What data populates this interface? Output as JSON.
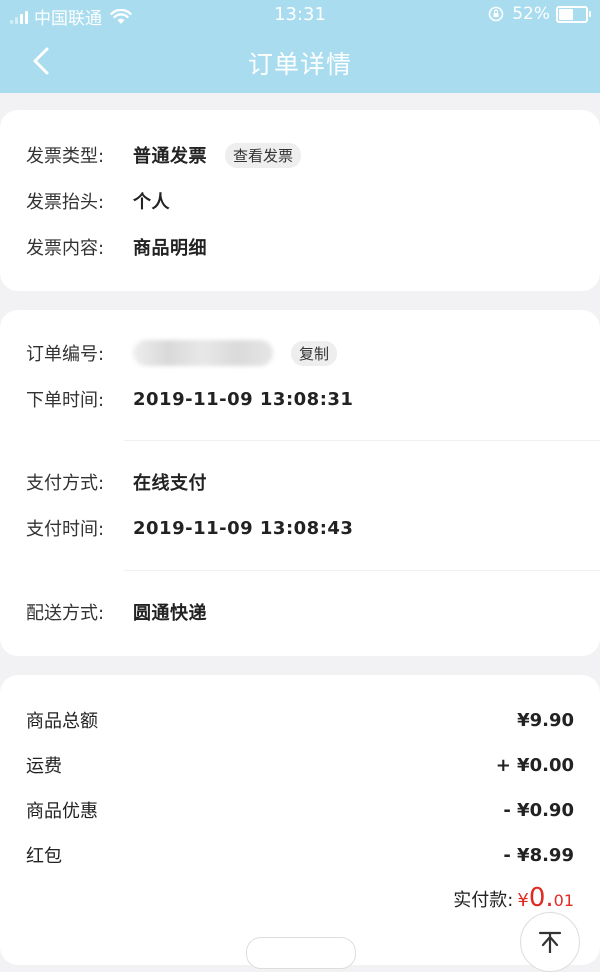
{
  "status_bar": {
    "carrier": "中国联通",
    "time": "13:31",
    "battery": "52%",
    "battery_level": 0.52
  },
  "header": {
    "title": "订单详情"
  },
  "invoice": {
    "type_label": "发票类型:",
    "type_value": "普通发票",
    "view_button": "查看发票",
    "title_label": "发票抬头:",
    "title_value": "个人",
    "content_label": "发票内容:",
    "content_value": "商品明细"
  },
  "order": {
    "number_label": "订单编号:",
    "copy_button": "复制",
    "time_label": "下单时间:",
    "time_value": "2019-11-09 13:08:31",
    "pay_method_label": "支付方式:",
    "pay_method_value": "在线支付",
    "pay_time_label": "支付时间:",
    "pay_time_value": "2019-11-09 13:08:43",
    "delivery_label": "配送方式:",
    "delivery_value": "圆通快递"
  },
  "amounts": {
    "goods_total_label": "商品总额",
    "goods_total_value": "¥9.90",
    "shipping_label": "运费",
    "shipping_value": "+ ¥0.00",
    "discount_label": "商品优惠",
    "discount_value": "- ¥0.90",
    "redpacket_label": "红包",
    "redpacket_value": "- ¥8.99",
    "paid_label": "实付款:",
    "paid_currency": "¥",
    "paid_integer": "0.",
    "paid_decimal": "01"
  },
  "colors": {
    "header_bg": "#a8dcee",
    "price_red": "#e02a22"
  }
}
